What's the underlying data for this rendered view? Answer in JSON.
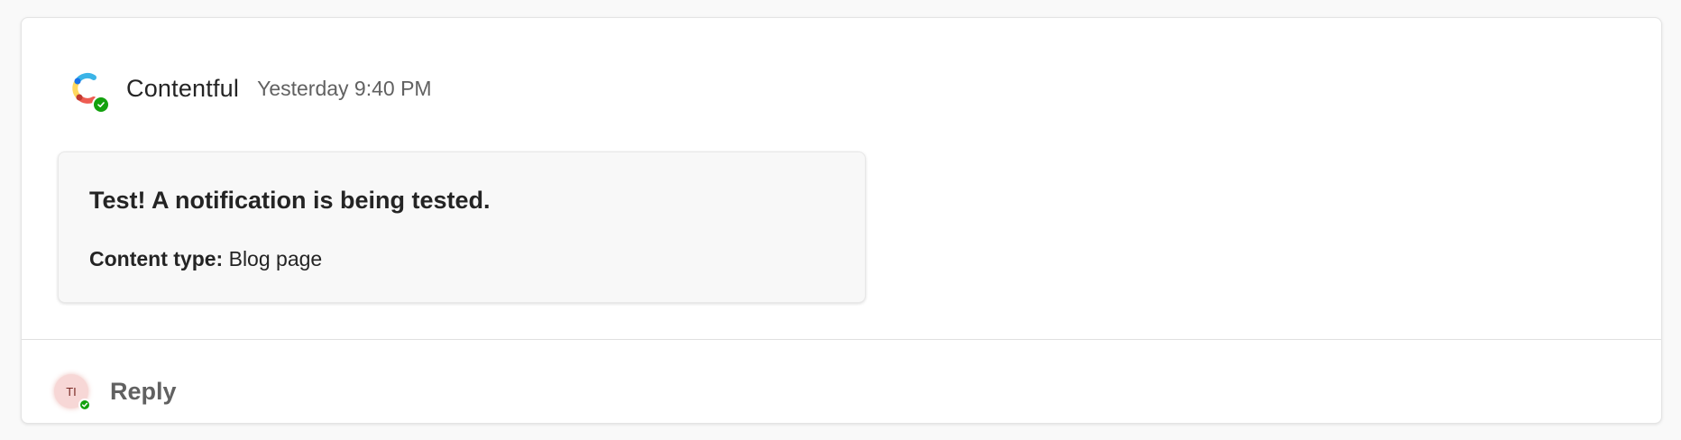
{
  "message": {
    "sender": "Contentful",
    "timestamp": "Yesterday 9:40 PM",
    "app_icon": "contentful-logo-icon",
    "presence_icon": "available-check-icon"
  },
  "card": {
    "title": "Test! A notification is being tested.",
    "fact_key": "Content type:",
    "fact_value": "Blog page"
  },
  "reply": {
    "avatar_initials": "TI",
    "label": "Reply"
  },
  "colors": {
    "presence": "#13a10e",
    "avatar_bg": "#f7d7d6",
    "logo_yellow": "#ffd85f",
    "logo_blue": "#3bb4e7",
    "logo_red": "#ee5c52",
    "logo_dark_blue": "#1773eb"
  }
}
